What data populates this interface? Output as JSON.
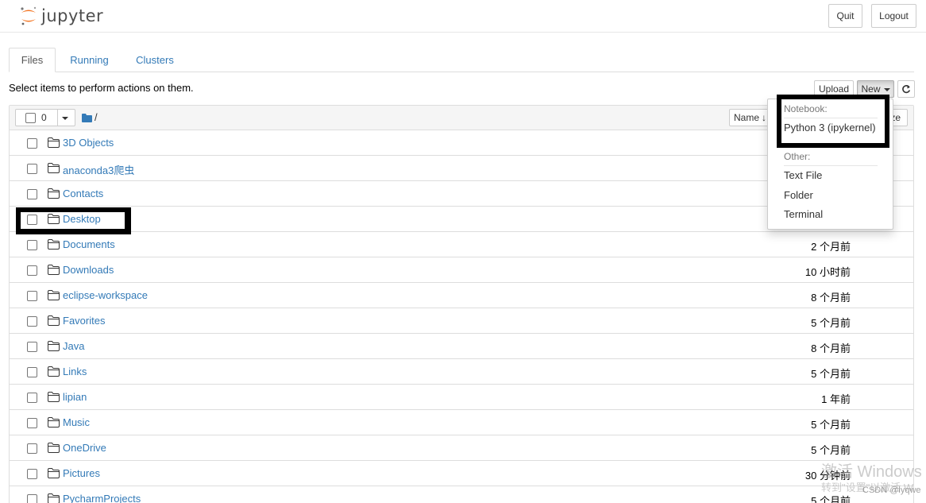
{
  "header": {
    "logo_text": "jupyter",
    "quit_label": "Quit",
    "logout_label": "Logout"
  },
  "tabs": [
    {
      "label": "Files",
      "active": true
    },
    {
      "label": "Running",
      "active": false
    },
    {
      "label": "Clusters",
      "active": false
    }
  ],
  "toolbar": {
    "instructions": "Select items to perform actions on them.",
    "upload_label": "Upload",
    "new_label": "New",
    "refresh_icon": "refresh-icon"
  },
  "list_header": {
    "selected_count": "0",
    "breadcrumb": "/",
    "name_sort_label": "Name",
    "size_label": "File size (partially hidden)"
  },
  "new_menu": {
    "notebook_header": "Notebook:",
    "python_kernel": "Python 3 (ipykernel)",
    "other_header": "Other:",
    "text_file": "Text File",
    "folder": "Folder",
    "terminal": "Terminal"
  },
  "files": [
    {
      "name": "3D Objects",
      "modified": ""
    },
    {
      "name": "anaconda3爬虫",
      "modified": ""
    },
    {
      "name": "Contacts",
      "modified": ""
    },
    {
      "name": "Desktop",
      "modified": ""
    },
    {
      "name": "Documents",
      "modified": "2 个月前"
    },
    {
      "name": "Downloads",
      "modified": "10 小时前"
    },
    {
      "name": "eclipse-workspace",
      "modified": "8 个月前"
    },
    {
      "name": "Favorites",
      "modified": "5 个月前"
    },
    {
      "name": "Java",
      "modified": "8 个月前"
    },
    {
      "name": "Links",
      "modified": "5 个月前"
    },
    {
      "name": "lipian",
      "modified": "1 年前"
    },
    {
      "name": "Music",
      "modified": "5 个月前"
    },
    {
      "name": "OneDrive",
      "modified": "5 个月前"
    },
    {
      "name": "Pictures",
      "modified": "30 分钟前"
    },
    {
      "name": "PycharmProjects",
      "modified": "5 个月前"
    }
  ],
  "watermark": {
    "line1": "激活 Windows",
    "line2": "转到\"设置\"以激活 W",
    "credit": "CSDN @lyqwe"
  },
  "colors": {
    "link": "#337ab7",
    "logo_orange": "#F37726"
  }
}
